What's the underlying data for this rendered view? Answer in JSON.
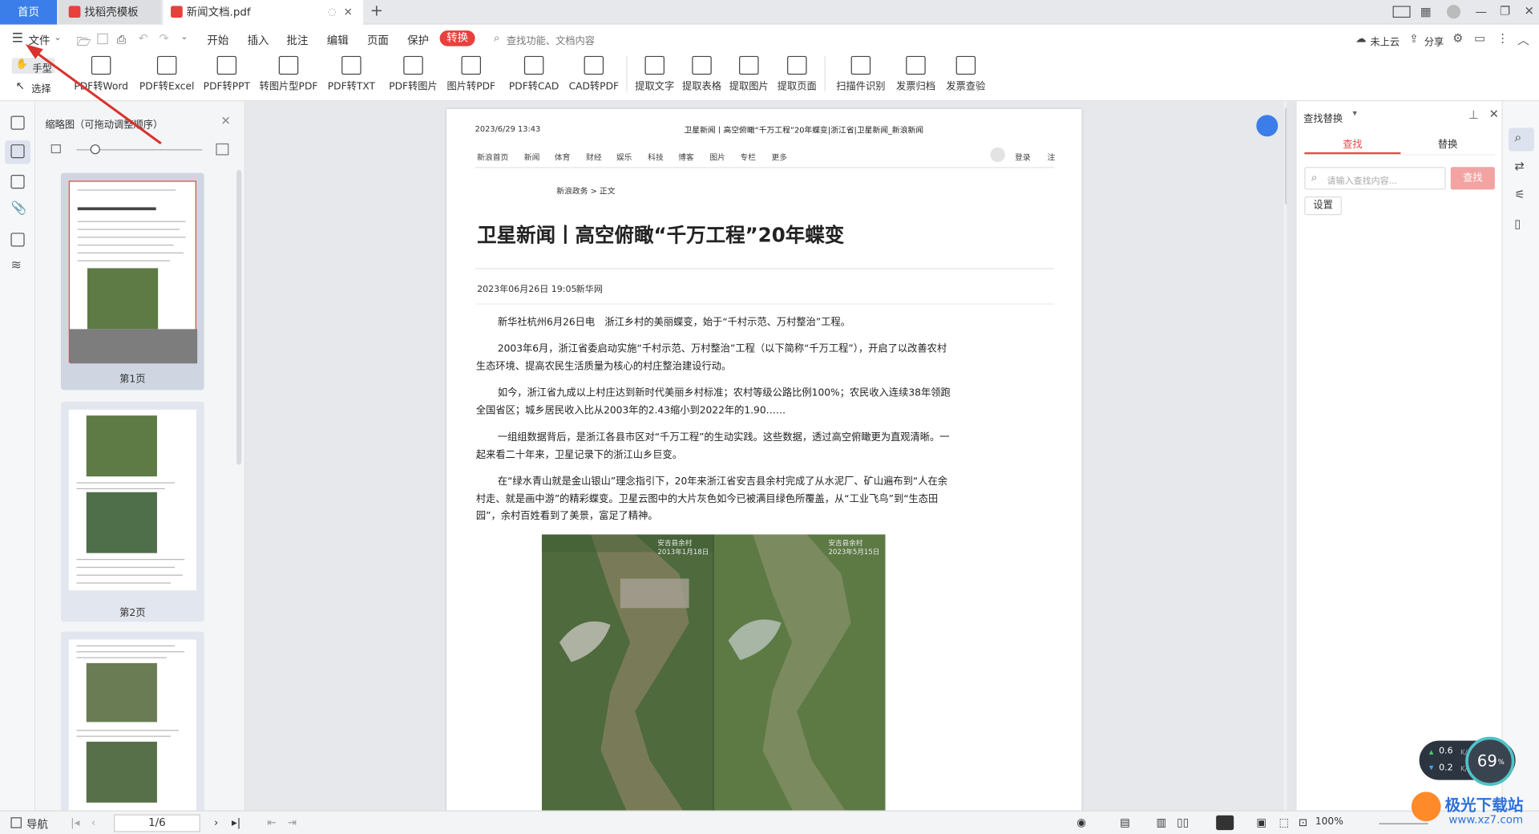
{
  "tabs": {
    "home": "首页",
    "template": "找稻壳模板",
    "doc": "新闻文档.pdf"
  },
  "menu": {
    "file": "文件",
    "items": [
      "开始",
      "插入",
      "批注",
      "编辑",
      "页面",
      "保护",
      "转换"
    ],
    "active": "转换",
    "search_placeholder": "查找功能、文档内容",
    "cloud": "未上云",
    "share": "分享"
  },
  "tools": {
    "hand": "手型",
    "select": "选择",
    "buttons": [
      "PDF转Word",
      "PDF转Excel",
      "PDF转PPT",
      "转图片型PDF",
      "PDF转TXT",
      "PDF转图片",
      "图片转PDF",
      "PDF转CAD",
      "CAD转PDF",
      "提取文字",
      "提取表格",
      "提取图片",
      "提取页面",
      "扫描件识别",
      "发票归档",
      "发票查验"
    ]
  },
  "thumbs": {
    "title": "缩略图（可拖动调整顺序）",
    "page1": "第1页",
    "page2": "第2页"
  },
  "doc": {
    "datetime": "2023/6/29 13:43",
    "header_title": "卫星新闻丨高空俯瞰“千万工程”20年蝶变|浙江省|卫星新闻_新浪新闻",
    "nav": [
      "新浪首页",
      "新闻",
      "体育",
      "财经",
      "娱乐",
      "科技",
      "博客",
      "图片",
      "专栏",
      "更多"
    ],
    "login": "登录",
    "reg": "注",
    "breadcrumb": "新浪政务 > 正文",
    "title": "卫星新闻丨高空俯瞰“千万工程”20年蝶变",
    "date": "2023年06月26日 19:05",
    "source": "新华网",
    "paragraphs": [
      "新华社杭州6月26日电　浙江乡村的美丽蝶变，始于“千村示范、万村整治”工程。",
      "2003年6月，浙江省委启动实施“千村示范、万村整治”工程（以下简称“千万工程”），开启了以改善农村生态环境、提高农民生活质量为核心的村庄整治建设行动。",
      "如今，浙江省九成以上村庄达到新时代美丽乡村标准；农村等级公路比例100%；农民收入连续38年领跑全国省区；城乡居民收入比从2003年的2.43缩小到2022年的1.90……",
      "一组组数据背后，是浙江各县市区对“千万工程”的生动实践。这些数据，透过高空俯瞰更为直观清晰。一起来看二十年来，卫星记录下的浙江山乡巨变。",
      "在“绿水青山就是金山银山”理念指引下，20年来浙江省安吉县余村完成了从水泥厂、矿山遍布到“人在余村走、就是画中游”的精彩蝶变。卫星云图中的大片灰色如今已被满目绿色所覆盖，从“工业飞鸟”到“生态田园”，余村百姓看到了美景，富足了精神。"
    ],
    "img_left_label": "安吉县余村\n2013年1月18日",
    "img_right_label": "安吉县余村\n2023年5月15日"
  },
  "find": {
    "title": "查找替换",
    "tab_find": "查找",
    "tab_replace": "替换",
    "placeholder": "请输入查找内容...",
    "find_btn": "查找",
    "settings": "设置"
  },
  "status": {
    "nav": "导航",
    "page": "1/6",
    "zoom": "100%"
  },
  "widget": {
    "up": "0.6",
    "down": "0.2",
    "unit": "K/s",
    "pct": "69",
    "pct_unit": "%"
  },
  "watermark": {
    "name": "极光下载站",
    "url": "www.xz7.com"
  },
  "colors": {
    "accent": "#3b7ee9",
    "convert": "#e8403c",
    "find_red": "#e94a48"
  }
}
